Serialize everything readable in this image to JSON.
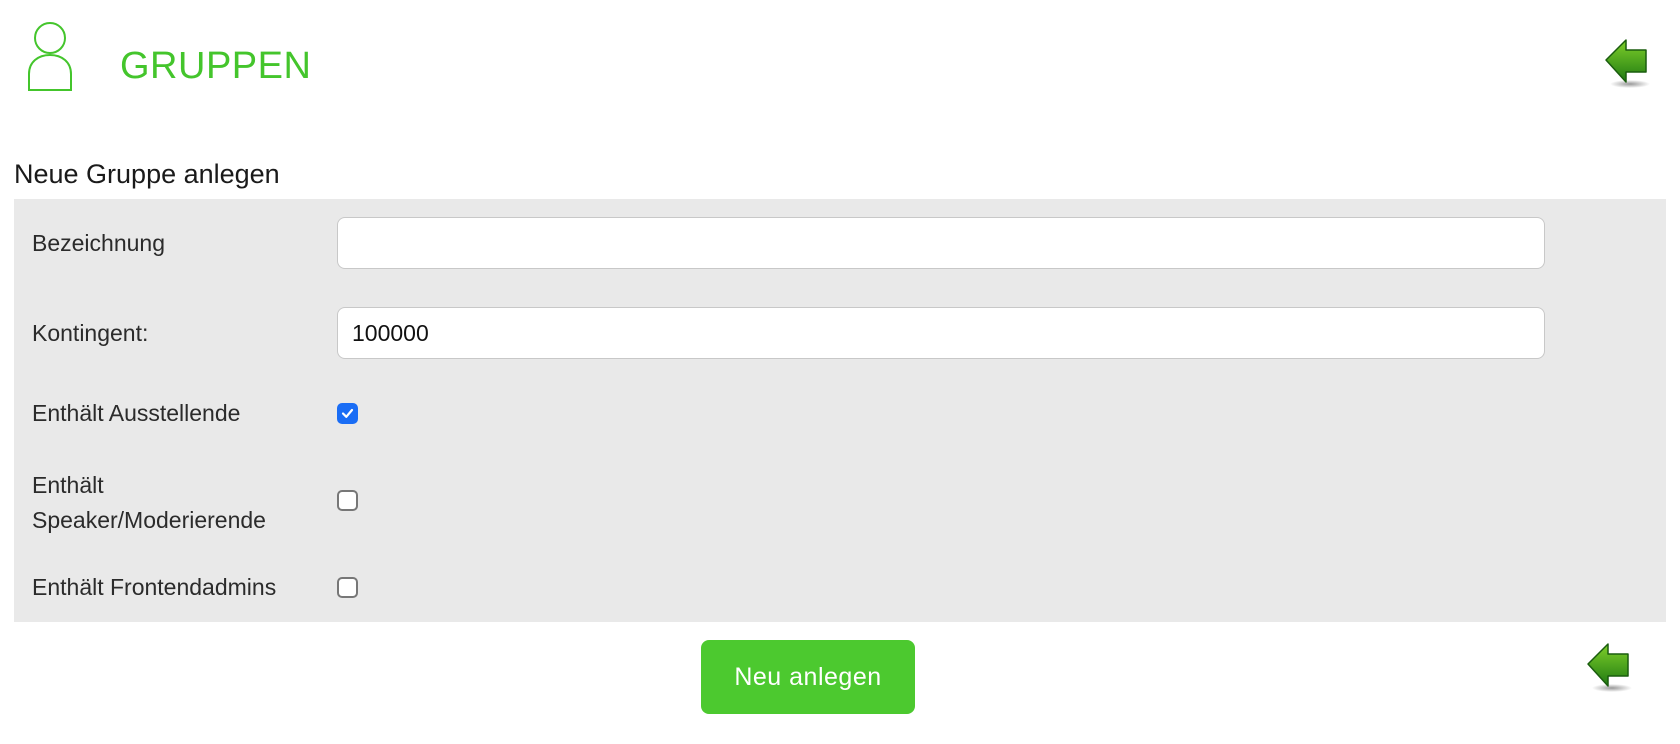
{
  "header": {
    "title": "GRUPPEN",
    "icon": "user-icon",
    "back_icon": "back-arrow-icon",
    "accent_color": "#44c52c"
  },
  "form": {
    "section_title": "Neue Gruppe anlegen",
    "fields": {
      "bezeichnung": {
        "label": "Bezeichnung",
        "value": "",
        "placeholder": ""
      },
      "kontingent": {
        "label": "Kontingent:",
        "value": "100000"
      }
    },
    "checkboxes": {
      "ausstellende": {
        "label": "Enthält Ausstellende",
        "checked": true
      },
      "speaker": {
        "label_line1": "Enthält",
        "label_line2": "Speaker/Moderierende",
        "checked": false
      },
      "frontendadmins": {
        "label": "Enthält Frontendadmins",
        "checked": false
      }
    },
    "submit_label": "Neu anlegen",
    "checkbox_color": "#1a6df5",
    "button_color": "#4cc92f"
  }
}
